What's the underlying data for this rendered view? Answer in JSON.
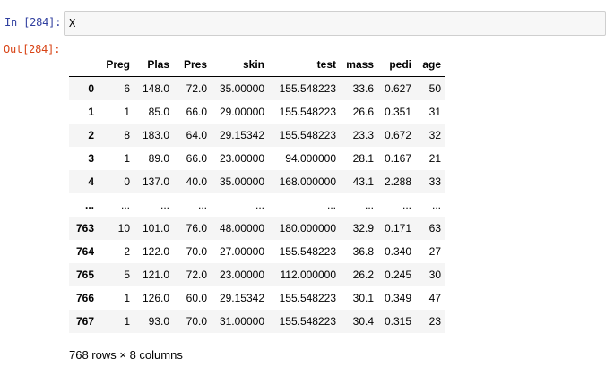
{
  "input_prompt": "In [284]:",
  "output_prompt": "Out[284]:",
  "code": "X",
  "dataframe": {
    "columns": [
      "Preg",
      "Plas",
      "Pres",
      "skin",
      "test",
      "mass",
      "pedi",
      "age"
    ],
    "rows": [
      {
        "index": "0",
        "values": [
          "6",
          "148.0",
          "72.0",
          "35.00000",
          "155.548223",
          "33.6",
          "0.627",
          "50"
        ]
      },
      {
        "index": "1",
        "values": [
          "1",
          "85.0",
          "66.0",
          "29.00000",
          "155.548223",
          "26.6",
          "0.351",
          "31"
        ]
      },
      {
        "index": "2",
        "values": [
          "8",
          "183.0",
          "64.0",
          "29.15342",
          "155.548223",
          "23.3",
          "0.672",
          "32"
        ]
      },
      {
        "index": "3",
        "values": [
          "1",
          "89.0",
          "66.0",
          "23.00000",
          "94.000000",
          "28.1",
          "0.167",
          "21"
        ]
      },
      {
        "index": "4",
        "values": [
          "0",
          "137.0",
          "40.0",
          "35.00000",
          "168.000000",
          "43.1",
          "2.288",
          "33"
        ]
      },
      {
        "index": "...",
        "values": [
          "...",
          "...",
          "...",
          "...",
          "...",
          "...",
          "...",
          "..."
        ]
      },
      {
        "index": "763",
        "values": [
          "10",
          "101.0",
          "76.0",
          "48.00000",
          "180.000000",
          "32.9",
          "0.171",
          "63"
        ]
      },
      {
        "index": "764",
        "values": [
          "2",
          "122.0",
          "70.0",
          "27.00000",
          "155.548223",
          "36.8",
          "0.340",
          "27"
        ]
      },
      {
        "index": "765",
        "values": [
          "5",
          "121.0",
          "72.0",
          "23.00000",
          "112.000000",
          "26.2",
          "0.245",
          "30"
        ]
      },
      {
        "index": "766",
        "values": [
          "1",
          "126.0",
          "60.0",
          "29.15342",
          "155.548223",
          "30.1",
          "0.349",
          "47"
        ]
      },
      {
        "index": "767",
        "values": [
          "1",
          "93.0",
          "70.0",
          "31.00000",
          "155.548223",
          "30.4",
          "0.315",
          "23"
        ]
      }
    ],
    "shape_text": "768 rows × 8 columns"
  }
}
